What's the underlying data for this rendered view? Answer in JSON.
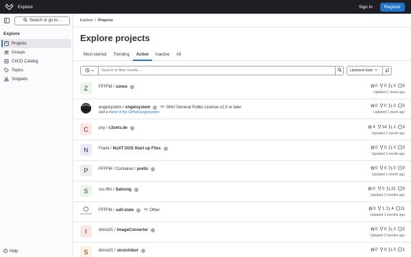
{
  "header": {
    "title": "Explore",
    "sign_in": "Sign in",
    "register": "Register"
  },
  "sidebar": {
    "search_label": "Search or go to...",
    "section_title": "Explore",
    "items": [
      {
        "label": "Projects",
        "icon": "project-icon"
      },
      {
        "label": "Groups",
        "icon": "group-icon"
      },
      {
        "label": "CI/CD Catalog",
        "icon": "catalog-icon"
      },
      {
        "label": "Topics",
        "icon": "tag-icon"
      },
      {
        "label": "Snippets",
        "icon": "snippet-icon"
      }
    ],
    "help": "Help"
  },
  "breadcrumb": {
    "root": "Explore",
    "sep": "/",
    "current": "Projects"
  },
  "page_title": "Explore projects",
  "tabs": [
    "Most starred",
    "Trending",
    "Active",
    "Inactive",
    "All"
  ],
  "active_tab": "Active",
  "filter": {
    "placeholder": "Search or filter results...",
    "sort": "Updated date"
  },
  "colors": {
    "accent": "#1f75cb",
    "header_bg": "#1f1e24"
  },
  "projects": [
    {
      "letter": "Z",
      "avatar_bg": "#e8f5e9",
      "namespace": "FFFFM / ",
      "name": "zones",
      "license": "",
      "desc": "",
      "desc_link": "",
      "desc_after": "",
      "stars": "0",
      "forks": "0",
      "mrs": "0",
      "issues": "0",
      "updated": "Updated 1 week ago"
    },
    {
      "letter": "",
      "avatar_bg": "#ffffff",
      "namespace": "engelsystem / ",
      "name": "engelsystem",
      "license": "GNU General Public License v2.0 or later",
      "desc": "Just a ",
      "desc_link": "mirror of the GitHub Engelsystem",
      "desc_after": "",
      "stars": "0",
      "forks": "0",
      "mrs": "0",
      "issues": "0",
      "updated": "Updated 1 week ago"
    },
    {
      "letter": "C",
      "avatar_bg": "#fbe5e1",
      "namespace": "psy / ",
      "name": "c3sets.de",
      "license": "",
      "desc": "",
      "desc_link": "",
      "desc_after": "",
      "stars": "4",
      "forks": "14",
      "mrs": "1",
      "issues": "3",
      "updated": "Updated 1 month ago"
    },
    {
      "letter": "N",
      "avatar_bg": "#ebe8f8",
      "namespace": "Frank / ",
      "name": "NuXT DOS Start up Files",
      "license": "",
      "desc": "",
      "desc_link": "",
      "desc_after": "",
      "stars": "0",
      "forks": "0",
      "mrs": "0",
      "issues": "0",
      "updated": "Updated 1 month ago"
    },
    {
      "letter": "P",
      "avatar_bg": "#ececef",
      "namespace": "FFFFM / Container / ",
      "name": "pretix",
      "license": "",
      "desc": "",
      "desc_link": "",
      "desc_after": "",
      "stars": "0",
      "forks": "0",
      "mrs": "0",
      "issues": "0",
      "updated": "Updated 1 month ago"
    },
    {
      "letter": "S",
      "avatar_bg": "#e8f5e9",
      "namespace": "ccc-ffm / ",
      "name": "Satzung",
      "license": "",
      "desc": "",
      "desc_link": "",
      "desc_after": "",
      "stars": "0",
      "forks": "0",
      "mrs": "21",
      "issues": "0",
      "updated": "Updated 2 months ago"
    },
    {
      "letter": "",
      "avatar_bg": "#ffffff",
      "namespace": "FFFFM / ",
      "name": "salt-state",
      "license": "Other",
      "desc": "",
      "desc_link": "",
      "desc_after": "",
      "stars": "3",
      "forks": "1",
      "mrs": "4",
      "issues": "11",
      "updated": "Updated 3 months ago"
    },
    {
      "letter": "I",
      "avatar_bg": "#fbe5e1",
      "namespace": "dmns01 / ",
      "name": "ImageConverter",
      "license": "",
      "desc": "",
      "desc_link": "",
      "desc_after": "",
      "stars": "0",
      "forks": "0",
      "mrs": "0",
      "issues": "0",
      "updated": "Updated 3 months ago"
    },
    {
      "letter": "S",
      "avatar_bg": "#fdf1dd",
      "namespace": "dmns01 / ",
      "name": "stroichibot",
      "license": "",
      "desc": "",
      "desc_link": "",
      "desc_after": "",
      "stars": "0",
      "forks": "0",
      "mrs": "0",
      "issues": "1",
      "updated": ""
    }
  ]
}
